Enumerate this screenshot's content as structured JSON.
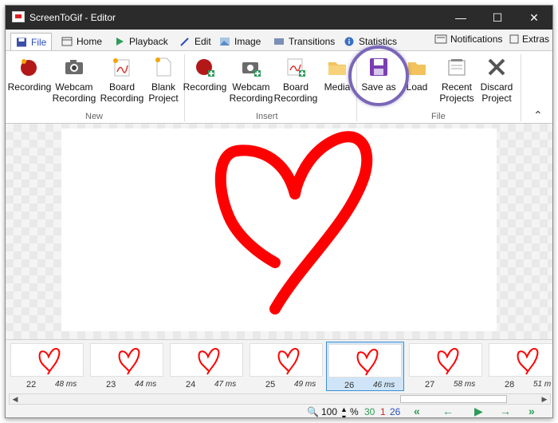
{
  "window": {
    "title": "ScreenToGif - Editor"
  },
  "titlebar": {
    "minimize_icon": "minimize-icon",
    "maximize_icon": "maximize-icon",
    "close_icon": "close-icon"
  },
  "tabs": [
    {
      "label": "File",
      "icon": "save-icon",
      "active": true
    },
    {
      "label": "Home",
      "icon": "home-icon"
    },
    {
      "label": "Playback",
      "icon": "play-icon"
    },
    {
      "label": "Edit",
      "icon": "pencil-icon"
    },
    {
      "label": "Image",
      "icon": "image-icon"
    },
    {
      "label": "Transitions",
      "icon": "transitions-icon"
    },
    {
      "label": "Statistics",
      "icon": "info-icon"
    }
  ],
  "tab_right": {
    "notifications": "Notifications",
    "extras": "Extras"
  },
  "ribbon": {
    "groups": [
      {
        "label": "New",
        "buttons": [
          {
            "line1": "Recording",
            "line2": "",
            "icon": "recording-icon"
          },
          {
            "line1": "Webcam",
            "line2": "Recording",
            "icon": "webcam-icon"
          },
          {
            "line1": "Board",
            "line2": "Recording",
            "icon": "board-icon"
          },
          {
            "line1": "Blank",
            "line2": "Project",
            "icon": "blank-project-icon"
          }
        ]
      },
      {
        "label": "Insert",
        "buttons": [
          {
            "line1": "Recording",
            "line2": "",
            "icon": "recording-add-icon"
          },
          {
            "line1": "Webcam",
            "line2": "Recording",
            "icon": "webcam-add-icon"
          },
          {
            "line1": "Board",
            "line2": "Recording",
            "icon": "board-add-icon"
          },
          {
            "line1": "Media",
            "line2": "",
            "icon": "folder-icon"
          }
        ]
      },
      {
        "label": "File",
        "buttons": [
          {
            "line1": "Save as",
            "line2": "",
            "icon": "save-as-icon"
          },
          {
            "line1": "Load",
            "line2": "",
            "icon": "folder-open-icon"
          },
          {
            "line1": "Recent",
            "line2": "Projects",
            "icon": "recent-projects-icon"
          },
          {
            "line1": "Discard",
            "line2": "Project",
            "icon": "discard-icon"
          }
        ]
      }
    ]
  },
  "frames": [
    {
      "num": "22",
      "dur": "48 ms"
    },
    {
      "num": "23",
      "dur": "44 ms"
    },
    {
      "num": "24",
      "dur": "47 ms"
    },
    {
      "num": "25",
      "dur": "49 ms"
    },
    {
      "num": "26",
      "dur": "46 ms",
      "selected": true
    },
    {
      "num": "27",
      "dur": "58 ms"
    },
    {
      "num": "28",
      "dur": "51 m"
    }
  ],
  "status": {
    "zoom": "100",
    "percent": "%",
    "frame_count": "30",
    "selected_count": "1",
    "current_frame": "26"
  },
  "colors": {
    "accent": "#2a4db5",
    "heart": "#ff0000",
    "highlight": "#7a66b8",
    "nav_green": "#2e9b5a"
  }
}
